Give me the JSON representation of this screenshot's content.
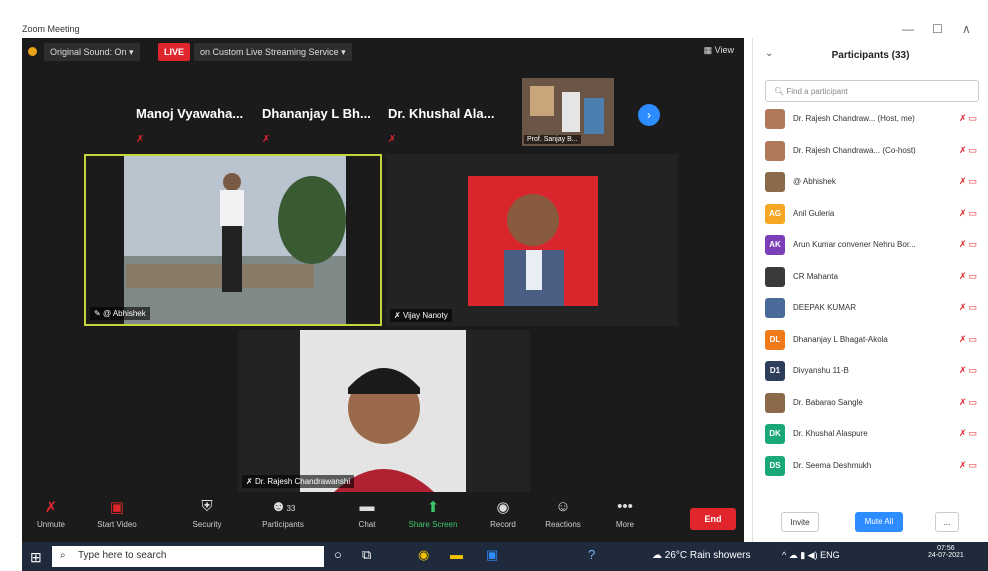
{
  "window": {
    "title": "Zoom Meeting",
    "controls": [
      "—",
      "☐",
      "∧"
    ]
  },
  "topbar": {
    "original_sound": "Original Sound: On",
    "live_badge": "LIVE",
    "streaming": "on Custom Live Streaming Service",
    "view": "View"
  },
  "strip": {
    "names": [
      "Manoj Vyawaha...",
      "Dhananjay L Bh...",
      "Dr. Khushal Ala..."
    ],
    "thumb_label": "Prof. Sanjay B..."
  },
  "tiles": {
    "tile1_label": "@ Abhishek",
    "tile2_label": "Vijay Nanoty",
    "tile3_label": "Dr. Rajesh Chandrawanshi"
  },
  "toolbar": {
    "items": [
      {
        "label": "Unmute",
        "icon": "mic-muted-icon"
      },
      {
        "label": "Start Video",
        "icon": "video-off-icon"
      },
      {
        "label": "Security",
        "icon": "shield-icon"
      },
      {
        "label": "Participants",
        "icon": "participants-icon",
        "count": "33"
      },
      {
        "label": "Chat",
        "icon": "chat-icon"
      },
      {
        "label": "Share Screen",
        "icon": "share-screen-icon"
      },
      {
        "label": "Record",
        "icon": "record-icon"
      },
      {
        "label": "Reactions",
        "icon": "reactions-icon"
      },
      {
        "label": "More",
        "icon": "more-icon"
      }
    ],
    "end": "End"
  },
  "panel": {
    "title": "Participants (33)",
    "search_placeholder": "Find a participant",
    "participants": [
      {
        "name": "Dr. Rajesh Chandraw... (Host, me)",
        "initials": "",
        "color": "#b07a5a"
      },
      {
        "name": "Dr. Rajesh Chandrawa... (Co-host)",
        "initials": "",
        "color": "#b07a5a"
      },
      {
        "name": "@ Abhishek",
        "initials": "",
        "color": "#8a6a4a"
      },
      {
        "name": "Anil Guleria",
        "initials": "AG",
        "color": "#f5a623"
      },
      {
        "name": "Arun Kumar convener Nehru Bor...",
        "initials": "AK",
        "color": "#7b3fb8"
      },
      {
        "name": "CR Mahanta",
        "initials": "",
        "color": "#3a3a3a"
      },
      {
        "name": "DEEPAK KUMAR",
        "initials": "",
        "color": "#4a6a9a"
      },
      {
        "name": "Dhananjay L Bhagat-Akola",
        "initials": "DL",
        "color": "#f07a1a"
      },
      {
        "name": "Divyanshu 11-B",
        "initials": "D1",
        "color": "#2c3e5a"
      },
      {
        "name": "Dr. Babarao Sangle",
        "initials": "",
        "color": "#8a6a4a"
      },
      {
        "name": "Dr. Khushal Alaspure",
        "initials": "DK",
        "color": "#1aa87a"
      },
      {
        "name": "Dr. Seema Deshmukh",
        "initials": "DS",
        "color": "#1aa87a"
      }
    ],
    "invite": "Invite",
    "mute_all": "Mute All",
    "more": "..."
  },
  "taskbar": {
    "search_placeholder": "Type here to search",
    "weather": "26°C  Rain showers",
    "tray": "^ ☁ ▮ ◀) ENG",
    "time": "07:56",
    "date": "24-07-2021"
  }
}
